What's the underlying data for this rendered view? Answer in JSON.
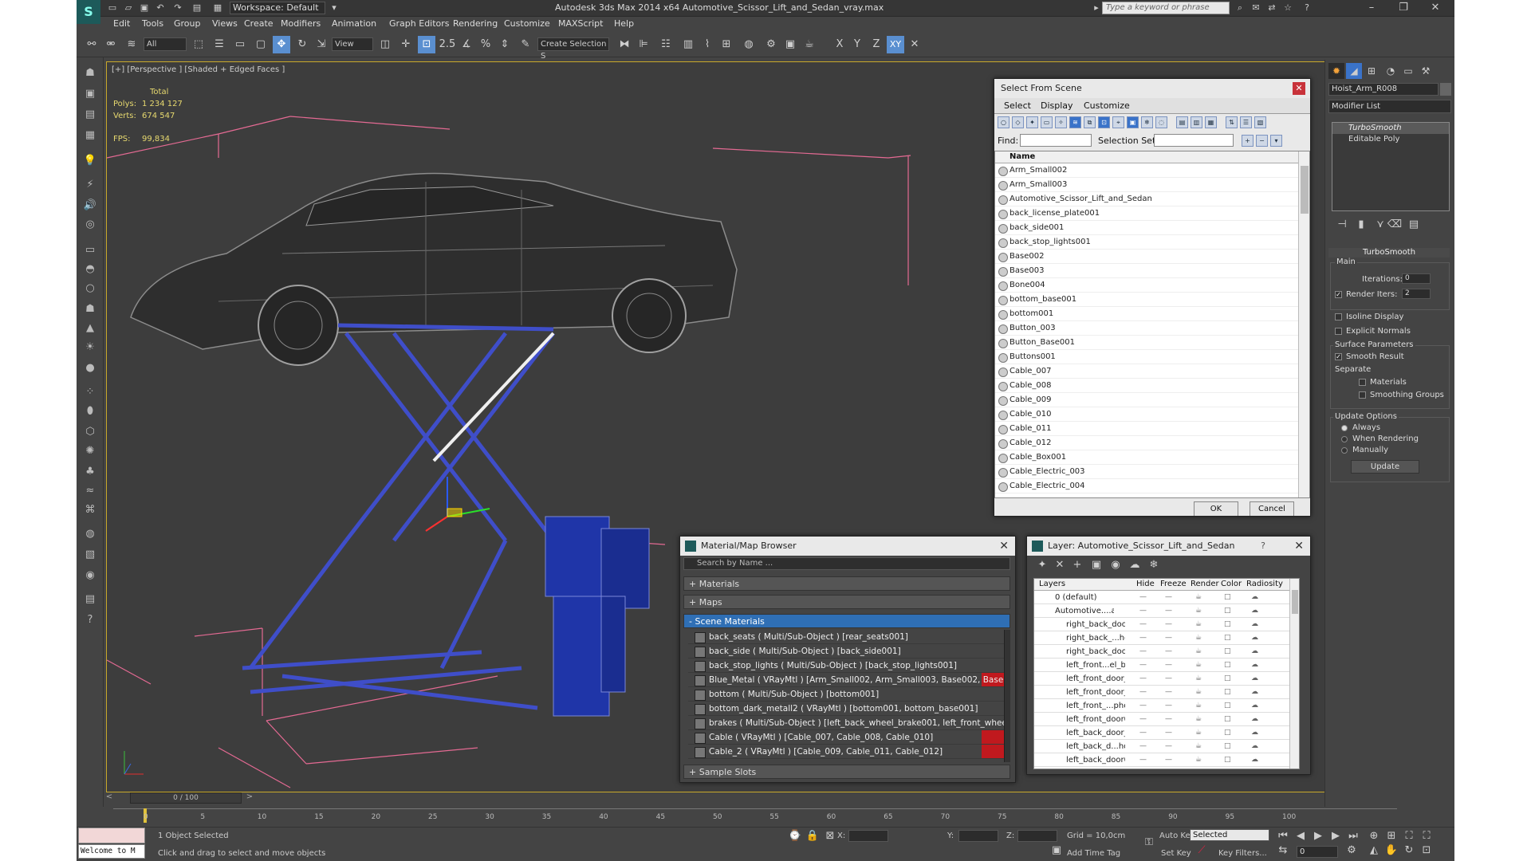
{
  "app": {
    "workspace": "Workspace: Default",
    "title": "Autodesk 3ds Max  2014 x64     Automotive_Scissor_Lift_and_Sedan_vray.max",
    "search_placeholder": "Type a keyword or phrase",
    "menus": [
      "Edit",
      "Tools",
      "Group",
      "Views",
      "Create",
      "Modifiers",
      "Animation",
      "Graph Editors",
      "Rendering",
      "Customize",
      "MAXScript",
      "Help"
    ]
  },
  "toolbar": {
    "filter": "All",
    "ref_coord": "View",
    "selection_set": "Create Selection S",
    "snap_label": "2.5",
    "axis_x": "X",
    "axis_y": "Y",
    "axis_z": "Z",
    "axis_xy": "XY"
  },
  "viewport": {
    "label": "[+] [Perspective ] [Shaded + Edged Faces ]",
    "stats_total": "Total",
    "polys_label": "Polys:",
    "polys": "1 234 127",
    "verts_label": "Verts:",
    "verts": "674 547",
    "fps_label": "FPS:",
    "fps": "99,834"
  },
  "select_from_scene": {
    "title": "Select From Scene",
    "tabs": [
      "Select",
      "Display",
      "Customize"
    ],
    "find_label": "Find:",
    "selection_set_label": "Selection Set:",
    "column": "Name",
    "items": [
      "Arm_Small002",
      "Arm_Small003",
      "Automotive_Scissor_Lift_and_Sedan",
      "back_license_plate001",
      "back_side001",
      "back_stop_lights001",
      "Base002",
      "Base003",
      "Bone004",
      "bottom_base001",
      "bottom001",
      "Button_003",
      "Button_Base001",
      "Buttons001",
      "Cable_007",
      "Cable_008",
      "Cable_009",
      "Cable_010",
      "Cable_011",
      "Cable_012",
      "Cable_Box001",
      "Cable_Electric_003",
      "Cable_Electric_004"
    ],
    "ok": "OK",
    "cancel": "Cancel"
  },
  "material_browser": {
    "title": "Material/Map Browser",
    "search_placeholder": "Search by Name ...",
    "materials": "+ Materials",
    "maps": "+ Maps",
    "scene_materials": "- Scene Materials",
    "sample_slots": "+ Sample Slots",
    "rows": [
      "back_seats  ( Multi/Sub-Object ) [rear_seats001]",
      "back_side  ( Multi/Sub-Object ) [back_side001]",
      "back_stop_lights  ( Multi/Sub-Object ) [back_stop_lights001]",
      "Blue_Metal  ( VRayMtl ) [Arm_Small002, Arm_Small003, Base002, Base003, Ca...",
      "bottom  ( Multi/Sub-Object ) [bottom001]",
      "bottom_dark_metall2  ( VRayMtl ) [bottom001, bottom_base001]",
      "brakes  ( Multi/Sub-Object ) [left_back_wheel_brake001, left_front_wheel_brak...",
      "Cable  ( VRayMtl ) [Cable_007, Cable_008, Cable_010]",
      "Cable_2  ( VRayMtl ) [Cable_009, Cable_011, Cable_012]"
    ]
  },
  "layer_dialog": {
    "title": "Layer: Automotive_Scissor_Lift_and_Sedan",
    "help": "?",
    "cols": [
      "Layers",
      "Hide",
      "Freeze",
      "Render",
      "Color",
      "Radiosity"
    ],
    "rows": [
      "0 (default)",
      "Automotive....and_",
      "right_back_door",
      "right_back_...ho",
      "right_back_door",
      "left_front...el_b",
      "left_front_door_",
      "left_front_door_",
      "left_front_...pho",
      "left_front_door0",
      "left_back_door_(",
      "left_back_d...ho",
      "left_back_door0"
    ]
  },
  "command_panel": {
    "object_name": "Hoist_Arm_R008",
    "modifier_list": "Modifier List",
    "stack": [
      "TurboSmooth",
      "Editable Poly"
    ],
    "rollout": "TurboSmooth",
    "main": "Main",
    "iterations_label": "Iterations:",
    "iterations": "0",
    "render_iters_label": "Render Iters:",
    "render_iters": "2",
    "isoline": "Isoline Display",
    "explicit": "Explicit Normals",
    "surface_params": "Surface Parameters",
    "smooth_result": "Smooth Result",
    "separate": "Separate",
    "materials": "Materials",
    "smoothing_groups": "Smoothing Groups",
    "update_options": "Update Options",
    "always": "Always",
    "when_rendering": "When Rendering",
    "manually": "Manually",
    "update": "Update"
  },
  "timeline": {
    "frame": "0 / 100",
    "ticks": [
      "0",
      "5",
      "10",
      "15",
      "20",
      "25",
      "30",
      "35",
      "40",
      "45",
      "50",
      "55",
      "60",
      "65",
      "70",
      "75",
      "80",
      "85",
      "90",
      "95",
      "100"
    ]
  },
  "status": {
    "welcome": "Welcome to M",
    "selected": "1 Object Selected",
    "prompt": "Click and drag to select and move objects",
    "x_label": "X:",
    "y_label": "Y:",
    "z_label": "Z:",
    "grid": "Grid = 10,0cm",
    "add_time_tag": "Add Time Tag",
    "auto_key": "Auto Key",
    "set_key": "Set Key",
    "key_mode": "Selected",
    "key_filters": "Key Filters...",
    "frame_field": "0"
  }
}
